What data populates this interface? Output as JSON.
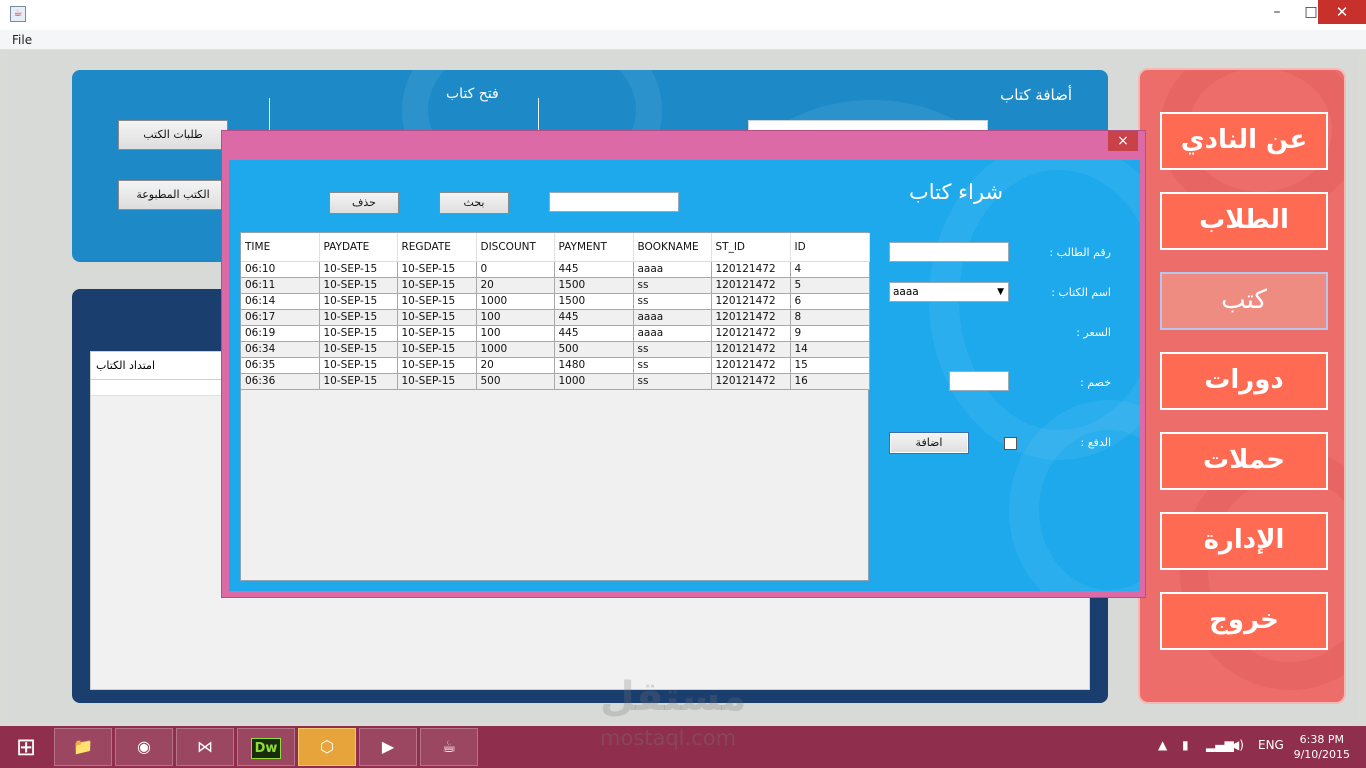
{
  "window": {
    "title_icon": "java-cup-icon",
    "close_glyph": "✕",
    "minimize_glyph": "–",
    "maximize_glyph": "□"
  },
  "menu": {
    "file": "File"
  },
  "top_panel": {
    "add_book": "أضافة كتاب",
    "open_book": "فتح كتاب",
    "book_requests": "طلبات الكتب",
    "printed_books": "الكتب المطبوعة"
  },
  "bottom_panel": {
    "extension_header": "امتداد الكتاب"
  },
  "nav": [
    {
      "label": "عن النادي"
    },
    {
      "label": "الطلاب"
    },
    {
      "label": "كتب"
    },
    {
      "label": "دورات"
    },
    {
      "label": "حملات"
    },
    {
      "label": "الإدارة"
    },
    {
      "label": "خروج"
    }
  ],
  "dialog": {
    "close_glyph": "×",
    "title": "شراء كتاب",
    "search_button": "بحث",
    "delete_button": "حذف",
    "form": {
      "student_no_label": "رقم الطالب :",
      "book_name_label": "اسم الكتاب :",
      "book_name_value": "aaaa",
      "price_label": "السعر :",
      "discount_label": "خصم :",
      "payment_label": "الدفع :",
      "add_button": "اضافة"
    },
    "table": {
      "columns": [
        "TIME",
        "PAYDATE",
        "REGDATE",
        "DISCOUNT",
        "PAYMENT",
        "BOOKNAME",
        "ST_ID",
        "ID"
      ],
      "rows": [
        [
          "06:10",
          "10-SEP-15",
          "10-SEP-15",
          "0",
          "445",
          "aaaa",
          "120121472",
          "4"
        ],
        [
          "06:11",
          "10-SEP-15",
          "10-SEP-15",
          "20",
          "1500",
          "ss",
          "120121472",
          "5"
        ],
        [
          "06:14",
          "10-SEP-15",
          "10-SEP-15",
          "1000",
          "1500",
          "ss",
          "120121472",
          "6"
        ],
        [
          "06:17",
          "10-SEP-15",
          "10-SEP-15",
          "100",
          "445",
          "aaaa",
          "120121472",
          "8"
        ],
        [
          "06:19",
          "10-SEP-15",
          "10-SEP-15",
          "100",
          "445",
          "aaaa",
          "120121472",
          "9"
        ],
        [
          "06:34",
          "10-SEP-15",
          "10-SEP-15",
          "1000",
          "500",
          "ss",
          "120121472",
          "14"
        ],
        [
          "06:35",
          "10-SEP-15",
          "10-SEP-15",
          "20",
          "1480",
          "ss",
          "120121472",
          "15"
        ],
        [
          "06:36",
          "10-SEP-15",
          "10-SEP-15",
          "500",
          "1000",
          "ss",
          "120121472",
          "16"
        ]
      ]
    }
  },
  "watermark": {
    "ar": "مستقل",
    "en": "mostaql.com"
  },
  "taskbar": {
    "apps": [
      "file-explorer-icon",
      "chrome-icon",
      "visual-studio-icon",
      "dreamweaver-icon",
      "virtualbox-icon",
      "media-center-icon",
      "java-icon"
    ],
    "dreamweaver_label": "Dw",
    "language": "ENG",
    "time": "6:38 PM",
    "date": "9/10/2015"
  },
  "colors": {
    "dialog_frame": "#db6aa6",
    "dialog_body": "#1ea9ec",
    "nav_panel": "#ec6d6a",
    "nav_button": "#ff6a52",
    "taskbar": "#8f2e4d"
  }
}
